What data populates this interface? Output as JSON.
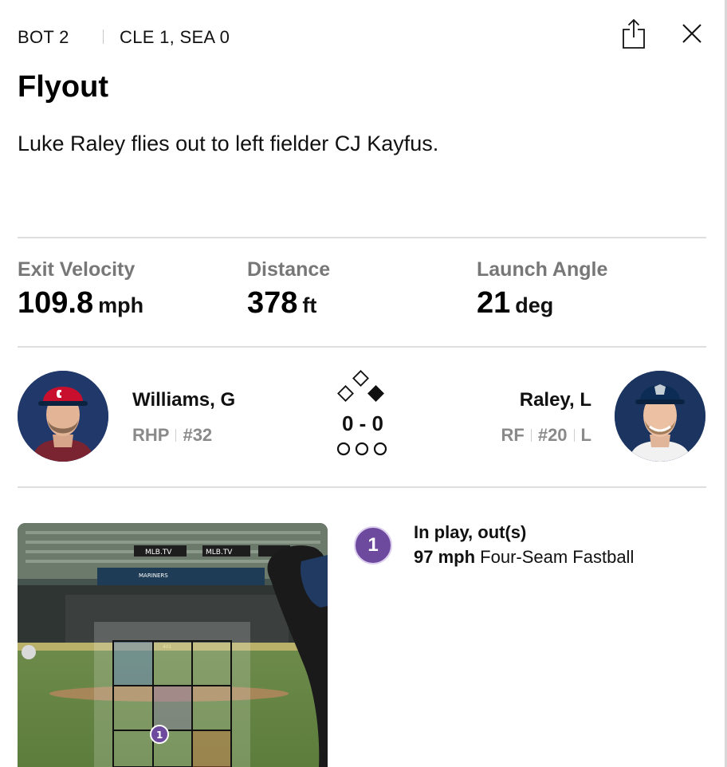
{
  "header": {
    "inning": "BOT 2",
    "score": "CLE 1, SEA 0",
    "share_icon": "share-icon",
    "close_icon": "close-icon"
  },
  "play": {
    "title": "Flyout",
    "description": "Luke Raley flies out to left fielder CJ Kayfus."
  },
  "stats": [
    {
      "label": "Exit Velocity",
      "value": "109.8",
      "unit": "mph"
    },
    {
      "label": "Distance",
      "value": "378",
      "unit": "ft"
    },
    {
      "label": "Launch Angle",
      "value": "21",
      "unit": "deg"
    }
  ],
  "pitcher": {
    "name": "Williams, G",
    "position": "RHP",
    "number": "#32",
    "team_color": "#c8102e"
  },
  "batter": {
    "name": "Raley, L",
    "position": "RF",
    "number": "#20",
    "bats": "L",
    "team_color": "#0c2c56"
  },
  "situation": {
    "count": "0 - 0",
    "bases": {
      "first": false,
      "second": false,
      "third": false
    },
    "outs": 0
  },
  "pitch": {
    "number": "1",
    "result": "In play, out(s)",
    "speed": "97 mph",
    "type": "Four-Seam Fastball",
    "badge_color": "#6e4a9e"
  },
  "video": {
    "board_text": "MLB.TV",
    "banner_text": "MARINERS",
    "wall_text": "401"
  }
}
